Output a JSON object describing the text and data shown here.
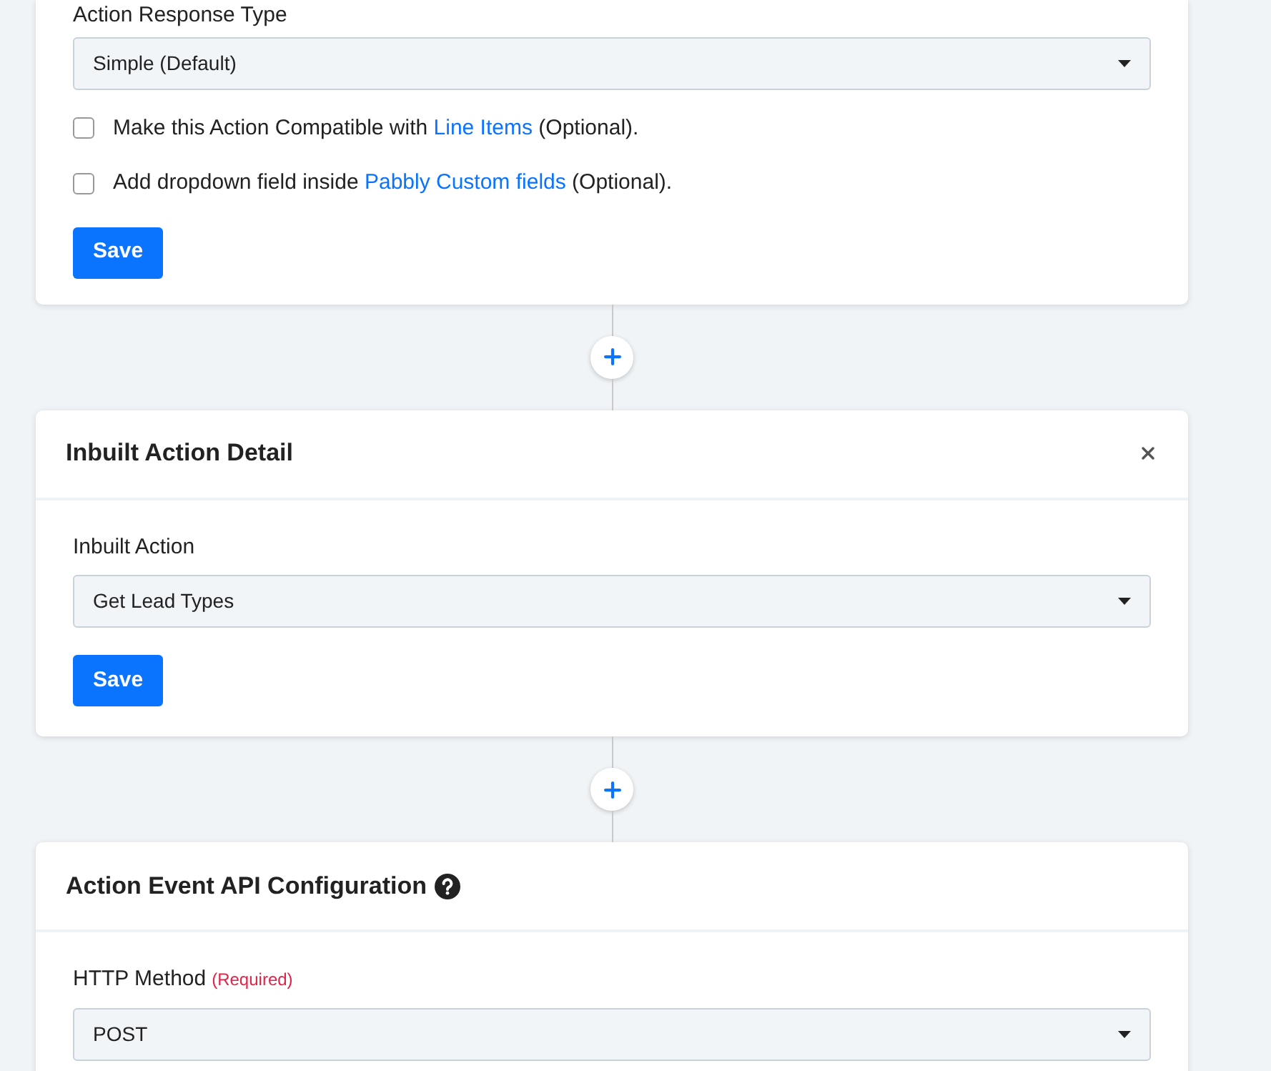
{
  "cards": [
    {
      "fields": [
        {
          "kind": "select",
          "label": "Action Response Type",
          "value": "Simple (Default)"
        },
        {
          "kind": "checkbox",
          "checked": false,
          "before": "Make this Action Compatible with",
          "link": "Line Items",
          "after": "(Optional)."
        },
        {
          "kind": "checkbox",
          "checked": false,
          "before": "Add dropdown field inside",
          "link": "Pabbly Custom fields",
          "after": "(Optional)."
        }
      ],
      "button": "Save"
    },
    {
      "header": {
        "title": "Inbuilt Action Detail",
        "closable": true,
        "help": false
      },
      "fields": [
        {
          "kind": "select",
          "label": "Inbuilt Action",
          "value": "Get Lead Types"
        }
      ],
      "button": "Save"
    },
    {
      "header": {
        "title": "Action Event API Configuration",
        "closable": false,
        "help": true
      },
      "fields": [
        {
          "kind": "select",
          "label": "HTTP Method",
          "required": "(Required)",
          "value": "POST"
        }
      ]
    }
  ]
}
